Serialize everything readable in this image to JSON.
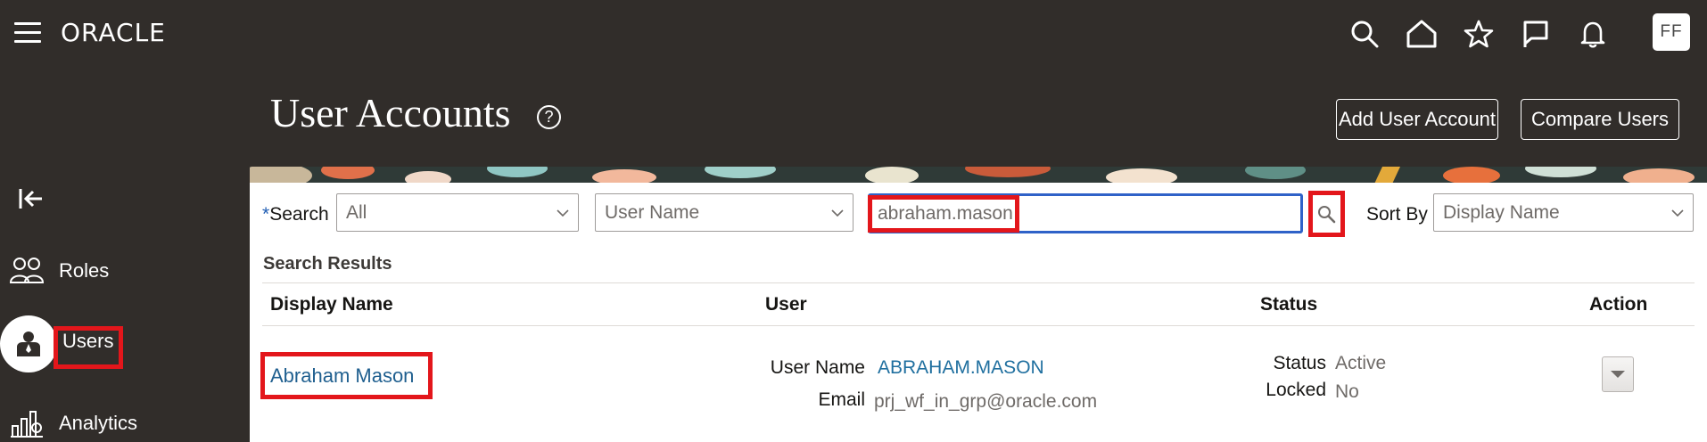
{
  "topbar": {
    "logo": "ORACLE",
    "avatar_initials": "FF",
    "icons": [
      "search-icon",
      "home-icon",
      "star-icon",
      "flag-icon",
      "bell-icon"
    ]
  },
  "header": {
    "title": "User Accounts",
    "help_glyph": "?",
    "add_user_label": "Add User Account",
    "compare_label": "Compare Users"
  },
  "sidebar": {
    "items": [
      {
        "label": "Roles",
        "icon": "roles-icon"
      },
      {
        "label": "Users",
        "icon": "user-icon",
        "selected": true
      },
      {
        "label": "Analytics",
        "icon": "analytics-icon"
      }
    ]
  },
  "search": {
    "required_mark": "*",
    "label": "Search",
    "scope_value": "All",
    "field_value": "User Name",
    "query_value": "abraham.mason",
    "sort_label": "Sort By",
    "sort_value": "Display Name"
  },
  "results": {
    "title": "Search Results",
    "columns": [
      "Display Name",
      "User",
      "Status",
      "Action"
    ],
    "rows": [
      {
        "display_name": "Abraham Mason",
        "user_name_label": "User Name",
        "user_name": "ABRAHAM.MASON",
        "email_label": "Email",
        "email": "prj_wf_in_grp@oracle.com",
        "status_label": "Status",
        "status": "Active",
        "locked_label": "Locked",
        "locked": "No"
      }
    ]
  },
  "colors": {
    "bar_bg": "#312d2a",
    "accent_blue": "#2f62c8",
    "link": "#1f5f8f",
    "highlight": "#e3161b"
  }
}
